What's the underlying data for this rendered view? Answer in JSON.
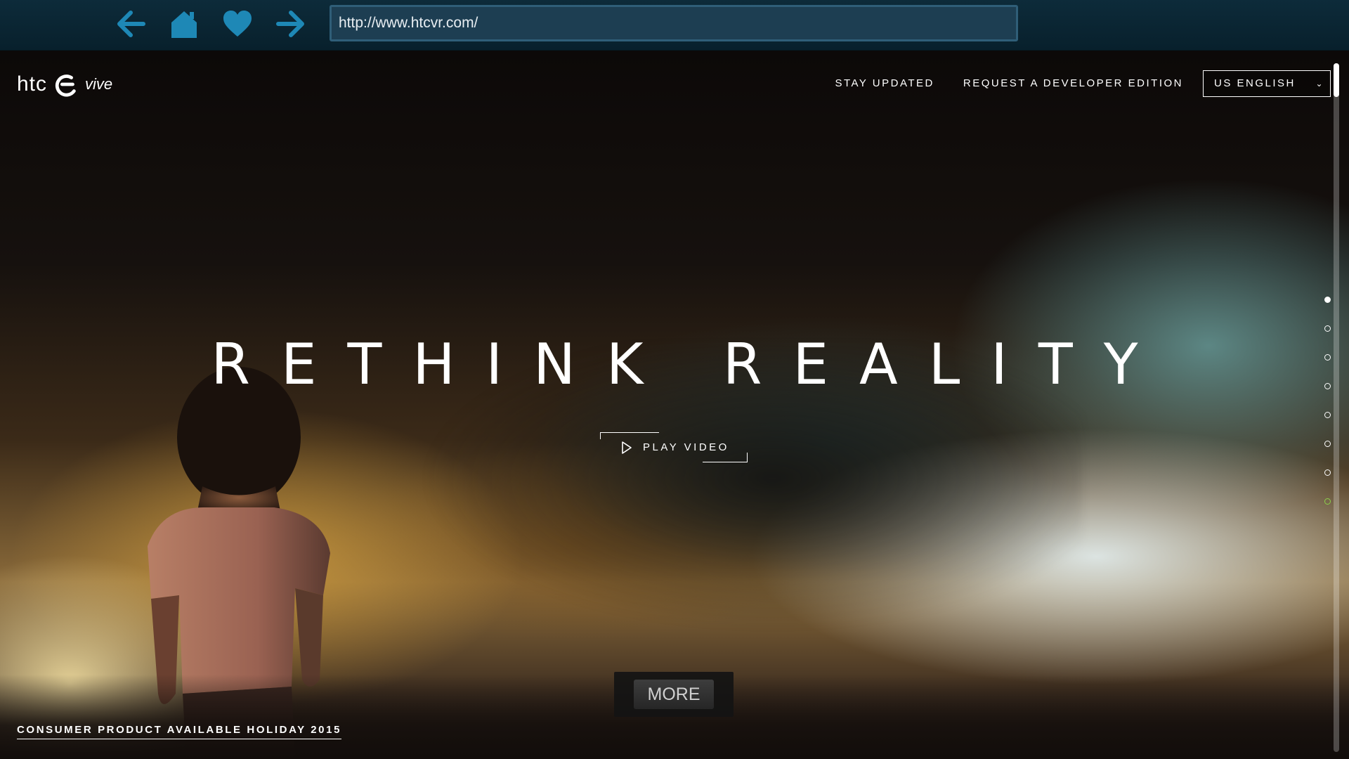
{
  "browser": {
    "back_icon": "arrow-left-icon",
    "home_icon": "home-icon",
    "favorite_icon": "heart-icon",
    "forward_icon": "arrow-right-icon",
    "url": "http://www.htcvr.com/",
    "icon_color": "#1e88b6"
  },
  "header": {
    "logo_htc": "htc",
    "logo_vive": "vive",
    "nav": [
      "STAY UPDATED",
      "REQUEST A DEVELOPER EDITION"
    ],
    "language": "US ENGLISH",
    "language_caret": "⌄"
  },
  "hero": {
    "title": "RETHINK REALITY",
    "play_label": "PLAY VIDEO"
  },
  "side_dots": {
    "count": 8,
    "active_index": 0,
    "accent_index": 7,
    "accent_color": "#8bd14a"
  },
  "footer": {
    "consumer_text": "CONSUMER PRODUCT AVAILABLE HOLIDAY 2015",
    "more_label": "MORE"
  }
}
